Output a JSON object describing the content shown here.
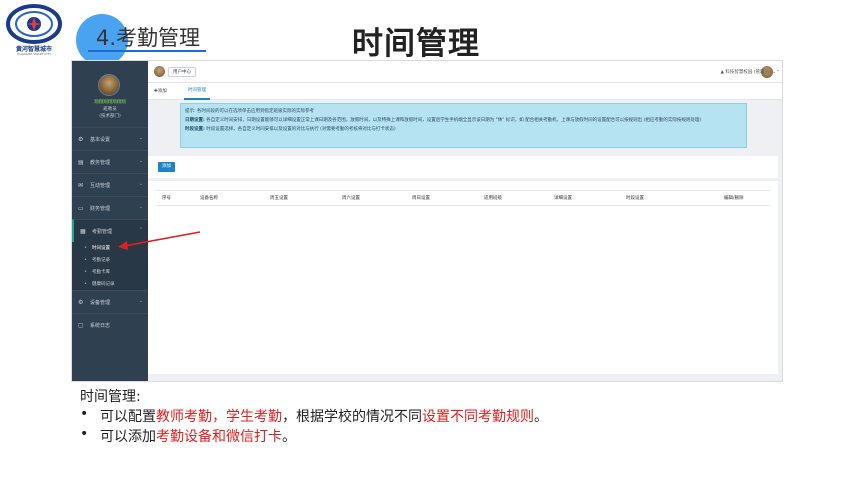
{
  "slide": {
    "logo_text": "黄河智慧城市",
    "logo_sub": "HUANGHE SMART CITY",
    "section_title": "4.考勤管理",
    "main_title": "时间管理"
  },
  "app": {
    "sidebar": {
      "user_name": "翔翔翔翔翔翔翔",
      "user_role": "班教员",
      "user_dept": "(技术部门)",
      "menu": [
        {
          "icon": "gear-icon",
          "glyph": "⚙",
          "label": "基本设置"
        },
        {
          "icon": "book-icon",
          "glyph": "▤",
          "label": "教务管理"
        },
        {
          "icon": "chat-icon",
          "glyph": "✉",
          "label": "互动管理"
        },
        {
          "icon": "card-icon",
          "glyph": "▭",
          "label": "财务管理"
        },
        {
          "icon": "calendar-icon",
          "glyph": "▦",
          "label": "考勤管理"
        }
      ],
      "submenu": [
        "时间设置",
        "考勤记录",
        "考勤卡库",
        "健康码记录"
      ],
      "menu_bottom": [
        {
          "icon": "cogs-icon",
          "glyph": "⚙",
          "label": "设备管理"
        },
        {
          "icon": "log-icon",
          "glyph": "▢",
          "label": "系统日志"
        }
      ]
    },
    "topbar": {
      "breadcrumb": "用户中心",
      "user": "▲ 科技智慧校园 (管理员) ⌄"
    },
    "tabs": {
      "add": "✚添加",
      "active": "时间管理"
    },
    "tip": {
      "line1": "提示: 各时间段的可以在选项单击应用到指定班级实际的实际参考",
      "line2_label": "日期设置:",
      "line2": " 各自定义时间安排，日期设置能够可以详细设置正常上课日期及各范围，放假时间，以及特殊上课和放假时间，设置后学生手机端全显示该日期为 \"休\" 标识，如 配合相关考勤机，上课与放假时间的设置配合可以按规则出 (相应考勤的实际按规则处理)",
      "line3_label": "时段设置:",
      "line3": " 时段设置选择，各自定义时间安排以及设置的对比与执行 (对需要考勤的考核将对比与打卡状态)"
    },
    "add_button": "添加",
    "table_headers": [
      "序号",
      "设备名称",
      "周五设置",
      "周六设置",
      "周日设置",
      "适用班级",
      "详细设置",
      "时段设置",
      "编辑/删除"
    ]
  },
  "notes": {
    "title": "时间管理:",
    "bullet1": {
      "pre": "可以配置",
      "red1": "教师考勤，学生考勤",
      "mid": "，根据学校的情况不同",
      "red2": "设置不同考勤规则",
      "post": "。"
    },
    "bullet2": {
      "pre": "可以添加",
      "red1": "考勤设备和微信打卡",
      "post": "。"
    }
  },
  "colors": {
    "sidebar": "#2f4050",
    "accent": "#1c84c6",
    "tip_bg": "#b6e3f2",
    "highlight_red": "#e02020",
    "badge": "#4aa3f0"
  }
}
